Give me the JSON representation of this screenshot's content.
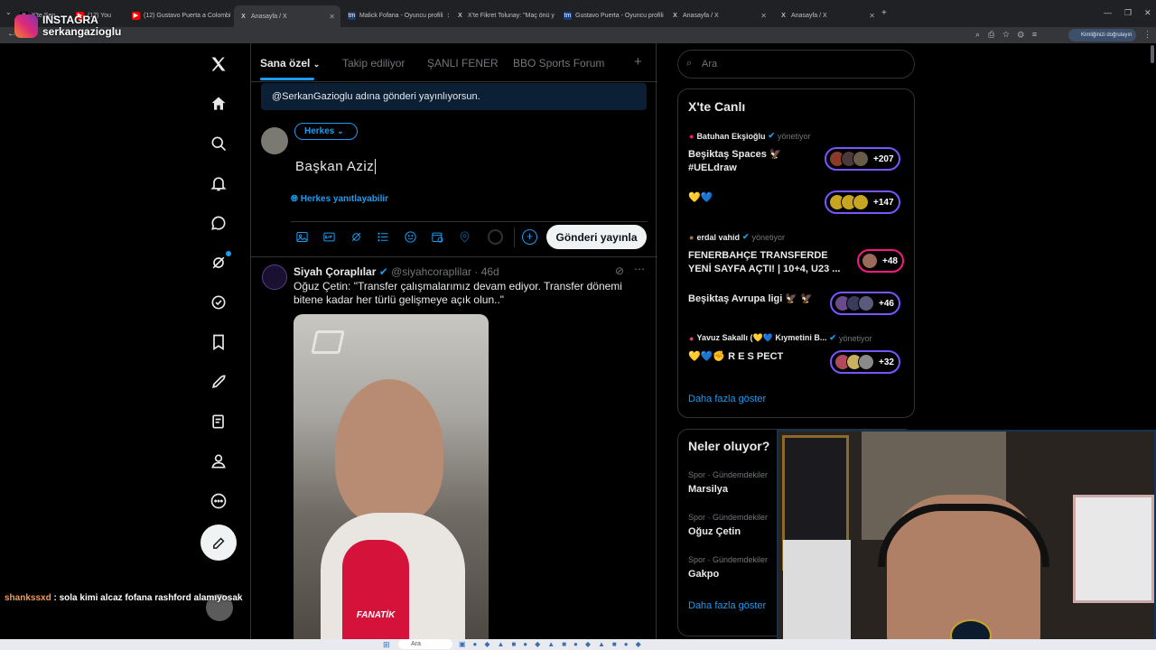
{
  "browser": {
    "tabs": [
      {
        "label": "X'te Sen",
        "color": "#000000"
      },
      {
        "label": "(12) You",
        "color": "#ff0000"
      },
      {
        "label": "(12) Gustavo Puerta a Colombi",
        "color": "#ff0000"
      },
      {
        "label": "Anasayfa / X",
        "color": "#000000"
      },
      {
        "label": "Malick Fofana - Oyuncu profili",
        "color": "#1a3d7a"
      },
      {
        "label": "X'te Fikret Tolunay: \"Maç önü y",
        "color": "#000000"
      },
      {
        "label": "Gustavo Puerta - Oyuncu profili",
        "color": "#1a3d7a"
      },
      {
        "label": "Anasayfa / X",
        "color": "#000000"
      },
      {
        "label": "Anasayfa / X",
        "color": "#000000"
      }
    ],
    "verify_label": "Kimliğinizi doğrulayın"
  },
  "overlay": {
    "instagram_label": "INSTAGRA",
    "instagram_handle": "serkangazioglu",
    "chat_user": "shankssxd",
    "chat_message": ": sola kimi alcaz fofana rashford alamıyosak"
  },
  "timeline": {
    "tabs": [
      "Sana özel",
      "Takip ediliyor",
      "ŞANLI FENER",
      "BBO Sports Forum"
    ],
    "add_tab": "+"
  },
  "composer": {
    "banner": "@SerkanGazioglu adına gönderi yayınlıyorsun.",
    "audience": "Herkes",
    "text": "Başkan Aziz",
    "reply_setting": "Herkes yanıtlayabilir",
    "post_button": "Gönderi yayınla"
  },
  "tweet": {
    "author_name": "Siyah Çoraplılar",
    "author_handle": "@siyahcoraplilar",
    "time": "46d",
    "text": "Oğuz Çetin: \"Transfer çalışmalarımız devam ediyor. Transfer dönemi bitene kadar her türlü gelişmeye açık olun..\"",
    "media_brand": "FANATİK"
  },
  "sidebar": {
    "search_placeholder": "Ara",
    "live_title": "X'te Canlı",
    "spaces": [
      {
        "host": "Batuhan Ekşioğlu",
        "role": "yönetiyor",
        "title": "Beşiktaş Spaces 🦅 #UELdraw",
        "count": "+207",
        "ring": "purple"
      },
      {
        "host": "",
        "role": "",
        "title": "💛💙",
        "count": "+147",
        "ring": "purple"
      },
      {
        "host": "erdal vahid",
        "role": "yönetiyor",
        "title": "FENERBAHÇE TRANSFERDE YENİ SAYFA AÇTI! | 10+4, U23 ...",
        "count": "+48",
        "ring": "pink"
      },
      {
        "host": "",
        "role": "",
        "title": "Beşiktaş Avrupa ligi 🦅 🦅",
        "count": "+46",
        "ring": "purple"
      },
      {
        "host": "Yavuz Sakallı (💛💙 Kıymetini B...",
        "role": "yönetiyor",
        "title": "💛💙✊ R E S PECT",
        "count": "+32",
        "ring": "purple"
      }
    ],
    "show_more": "Daha fazla göster",
    "trends_title": "Neler oluyor?",
    "trends": [
      {
        "category": "Spor · Gündemdekiler",
        "name": "Marsilya"
      },
      {
        "category": "Spor · Gündemdekiler",
        "name": "Oğuz Çetin"
      },
      {
        "category": "Spor · Gündemdekiler",
        "name": "Gakpo"
      }
    ],
    "trends_more": "Daha fazla göster"
  },
  "taskbar": {
    "search": "Ara"
  },
  "colors": {
    "accent": "#1d9bf0",
    "space_ring": "#7856ff",
    "space_ring_live": "#f91880"
  }
}
